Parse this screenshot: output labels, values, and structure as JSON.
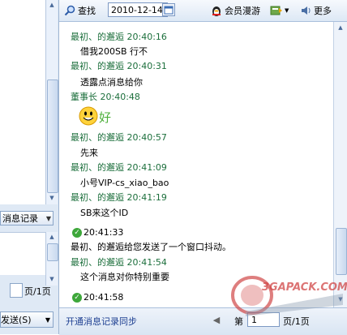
{
  "left_panel": {
    "msg_record_label": "消息记录",
    "page_suffix": "页/1页",
    "send_label": "发送(S)"
  },
  "toolbar": {
    "find_label": "查找",
    "date_value": "2010-12-14",
    "member_roam_label": "会员漫游",
    "more_label": "更多"
  },
  "messages": [
    {
      "type": "header",
      "text": "最初、的邂逅 20:40:16"
    },
    {
      "type": "body",
      "text": "借我200SB  行不"
    },
    {
      "type": "header",
      "text": "最初、的邂逅 20:40:31"
    },
    {
      "type": "body",
      "text": "透露点消息给你"
    },
    {
      "type": "header",
      "text": "董事长 20:40:48"
    },
    {
      "type": "emote",
      "text": "好"
    },
    {
      "type": "header",
      "text": "最初、的邂逅 20:40:57"
    },
    {
      "type": "body",
      "text": "先来"
    },
    {
      "type": "header",
      "text": "最初、的邂逅 20:41:09"
    },
    {
      "type": "body",
      "text": "小号VIP-cs_xiao_bao"
    },
    {
      "type": "header",
      "text": "最初、的邂逅 20:41:19"
    },
    {
      "type": "body",
      "text": "SB来这个ID"
    },
    {
      "type": "system_time",
      "text": "20:41:33"
    },
    {
      "type": "system",
      "text": "最初、的邂逅给您发送了一个窗口抖动。"
    },
    {
      "type": "header",
      "text": "最初、的邂逅 20:41:54"
    },
    {
      "type": "body",
      "text": "这个消息对你特别重要"
    },
    {
      "type": "system_time",
      "text": "20:41:58"
    }
  ],
  "footer": {
    "sync_link": "开通消息记录同步",
    "page_label": "第",
    "page_value": "1",
    "page_total": "页/1页"
  },
  "watermark": {
    "text": "3GAPACK.COM"
  }
}
